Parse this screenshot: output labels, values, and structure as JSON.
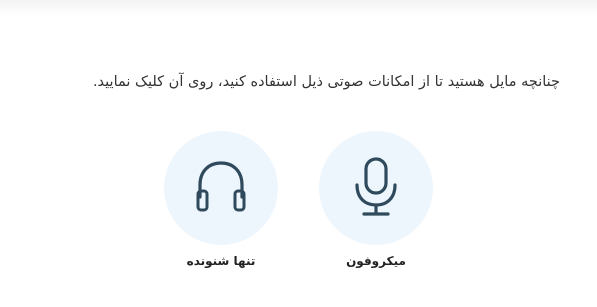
{
  "prompt": {
    "text": "چنانچه مایل هستید تا از امکانات صوتی ذیل استفاده کنید، روی آن کلیک نمایید."
  },
  "options": [
    {
      "label": "میکروفون",
      "icon": "microphone-icon"
    },
    {
      "label": "تنها شنونده",
      "icon": "headphones-icon"
    }
  ],
  "colors": {
    "circle_background": "#eef6fd",
    "icon_stroke": "#2f4a5c",
    "text": "#333333"
  }
}
